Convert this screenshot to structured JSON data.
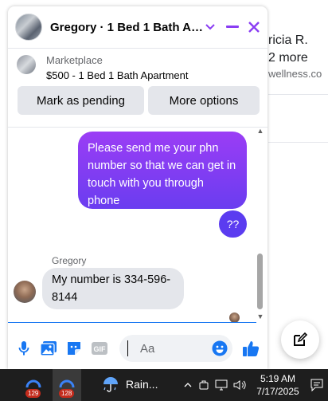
{
  "background": {
    "fragments": [
      "ricia R.",
      "2 more",
      "wellness.co"
    ]
  },
  "chat": {
    "title": "Gregory · 1 Bed 1 Bath Apartment",
    "listing": {
      "source": "Marketplace",
      "title": "$500 - 1 Bed 1 Bath Apartment"
    },
    "buttons": {
      "mark_pending": "Mark as pending",
      "more_options": "More options"
    },
    "messages": [
      {
        "from": "me",
        "text": "Please send me your phn number so that we can get in touch with you through phone"
      },
      {
        "from": "me",
        "text": "??"
      },
      {
        "from": "Gregory",
        "sender_label": "Gregory",
        "text": "My number is 334-596-8144"
      }
    ],
    "composer": {
      "placeholder": "Aa"
    }
  },
  "taskbar": {
    "apps": [
      {
        "name": "browser",
        "badge": "129"
      },
      {
        "name": "browser",
        "badge": "128"
      }
    ],
    "weather": "Rain...",
    "time": "5:19 AM",
    "date": "7/17/2025"
  },
  "colors": {
    "accent": "#8a3df3",
    "bubble_gradient_top": "#9b3df5",
    "bubble_gradient_bottom": "#6a3df0",
    "messenger_blue": "#1877f2",
    "taskbar": "#1e1e1e"
  }
}
